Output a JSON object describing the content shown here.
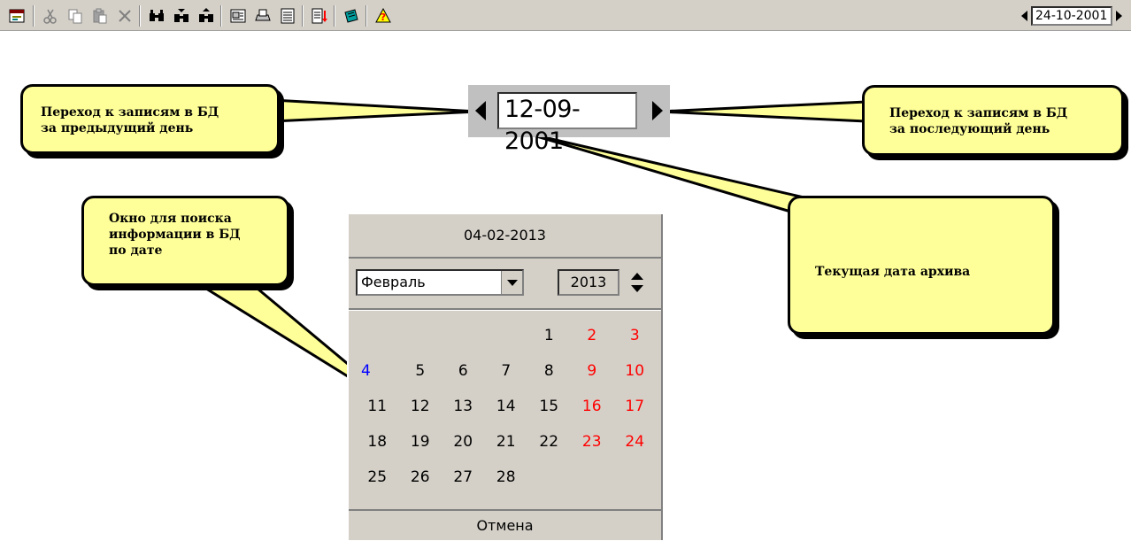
{
  "toolbar": {
    "icons": [
      "form-icon",
      "cut-icon",
      "copy-icon",
      "paste-icon",
      "delete-icon",
      "find-icon",
      "find-next-icon",
      "find-previous-icon",
      "report-icon",
      "print-icon",
      "list-icon",
      "export-icon",
      "edit-icon",
      "help-icon"
    ],
    "date_value": "24-10-2001"
  },
  "navigator": {
    "date_value": "12-09-2001"
  },
  "callouts": {
    "prev_day": [
      "Переход к записям в БД",
      "за предыдущий день"
    ],
    "next_day": [
      "Переход к записям в БД",
      "за последующий день"
    ],
    "search": [
      "Окно для поиска",
      "информации в БД",
      "по дате"
    ],
    "current_date": "Текущая дата архива"
  },
  "calendar": {
    "header_date": "04-02-2013",
    "month": "Февраль",
    "year": "2013",
    "cancel_label": "Отмена",
    "colors": {
      "weekend": "#ff0000",
      "today": "#0000ff"
    },
    "weeks": [
      [
        "",
        "",
        "",
        "",
        "1",
        "2",
        "3"
      ],
      [
        "4",
        "5",
        "6",
        "7",
        "8",
        "9",
        "10"
      ],
      [
        "11",
        "12",
        "13",
        "14",
        "15",
        "16",
        "17"
      ],
      [
        "18",
        "19",
        "20",
        "21",
        "22",
        "23",
        "24"
      ],
      [
        "25",
        "26",
        "27",
        "28",
        "",
        "",
        ""
      ]
    ]
  }
}
